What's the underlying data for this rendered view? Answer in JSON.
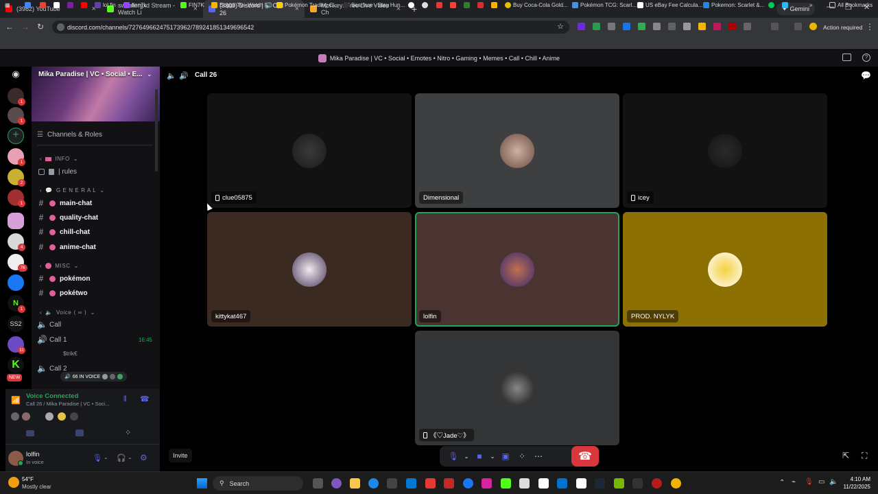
{
  "browser": {
    "tabs": [
      {
        "title": "(3982) YouTube",
        "color": "#ff0000",
        "active": false
      },
      {
        "title": "sweatergxd Stream - Watch Li",
        "color": "#53fc18",
        "active": false
      },
      {
        "title": "(3303) Discord | 🔊Call 26",
        "color": "#5865f2",
        "active": true
      },
      {
        "title": "Monkey: Free Live Video Ch",
        "color": "#f5a623",
        "active": false
      }
    ],
    "new_tab": "+",
    "gemini": "Gemini",
    "url": "discord.com/channels/727649662475173962/789241851349696542",
    "action_required": "Action required",
    "bookmarks": [
      "lol fin",
      "finn7k",
      "FIN7K",
      "Bogge Tv - Watch F...",
      "Pokémon Trading C...",
      "Scarface - Stay Hun...",
      "Buy Coca-Cola Gold...",
      "Pokémon TCG: Scarl...",
      "US eBay Fee Calcula...",
      "Pokemon: Scarlet &...",
      "All Bookmarks"
    ]
  },
  "discord": {
    "server_title": "Mika Paradise | VC • Social • Emotes • Nitro • Gaming • Memes • Call • Chill • Anime",
    "server_name": "Mika Paradise | VC • Social • E...",
    "channels_roles": "Channels & Roles",
    "categories": {
      "info": "INFO",
      "general": "G E N E R A L",
      "misc": "MISC",
      "voice": "Voice ⟨ ∞ ⟩"
    },
    "channels": {
      "rules": "| rules",
      "main": "main-chat",
      "quality": "quality-chat",
      "chill": "chill-chat",
      "anime": "anime-chat",
      "pokemon": "pokémon",
      "poketwo": "pokétwo",
      "call": "Call",
      "call1": "Call 1",
      "call1_time": "16:45",
      "call1_user": "$trik€",
      "call2": "Call 2",
      "in_voice": "66 IN VOICE"
    },
    "voice_status": {
      "title": "Voice Connected",
      "subtitle": "Call 26 / Mika Paradise | VC • Soci..."
    },
    "user": {
      "name": "lolfin",
      "status": "In voice"
    },
    "call_title": "Call 26",
    "invite": "Invite",
    "participants": [
      {
        "name": "clue05875",
        "mobile": true
      },
      {
        "name": "Dimensional",
        "mobile": false
      },
      {
        "name": "icey",
        "mobile": true
      },
      {
        "name": "kittykat467",
        "mobile": false
      },
      {
        "name": "lolfin",
        "mobile": false,
        "speaking": true
      },
      {
        "name": "PROD. NYLYK",
        "mobile": false
      },
      {
        "name": "《♡Jade♡》",
        "mobile": true
      }
    ]
  },
  "taskbar": {
    "temp": "54°F",
    "weather": "Mostly clear",
    "search": "Search",
    "time": "4:10 AM",
    "date": "11/22/2025"
  }
}
